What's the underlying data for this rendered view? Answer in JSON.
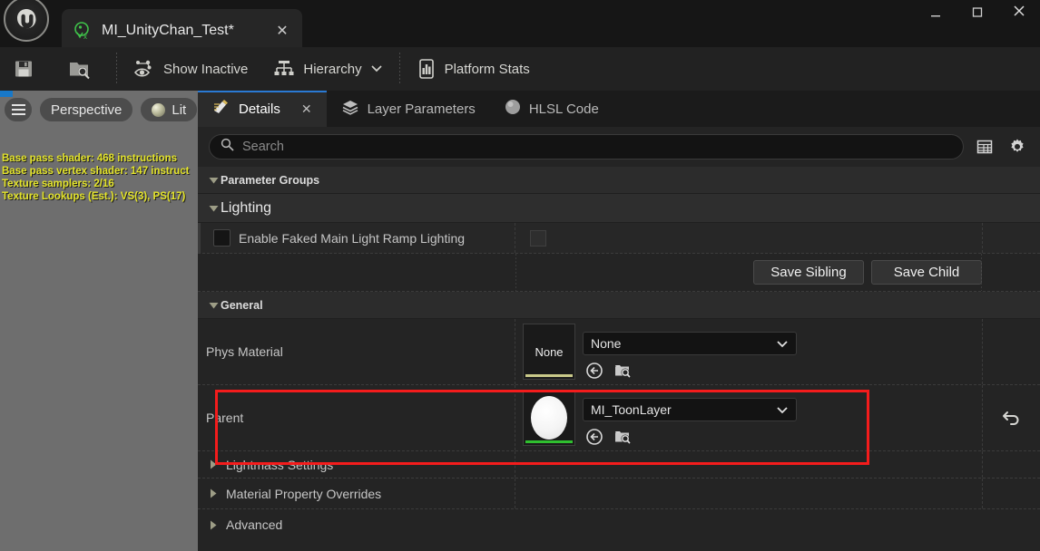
{
  "window": {
    "minimize_label": "–",
    "maximize_label": "❐",
    "close_label": "✕",
    "logo_name": "unreal-engine-logo"
  },
  "document_tab": {
    "title": "MI_UnityChan_Test*",
    "close_label": "✕",
    "icon": "material-instance-icon"
  },
  "toolbar": {
    "save_label": "",
    "browse_label": "",
    "show_inactive_label": "Show Inactive",
    "hierarchy_label": "Hierarchy",
    "hierarchy_caret": "⌄",
    "platform_stats_label": "Platform Stats"
  },
  "viewport": {
    "menu_icon": "hamburger-icon",
    "camera_mode": "Perspective",
    "view_mode": "Lit",
    "stats": [
      "Base pass shader: 468 instructions",
      "Base pass vertex shader: 147 instruct",
      "Texture samplers: 2/16",
      "Texture Lookups (Est.): VS(3), PS(17)"
    ]
  },
  "panel_tabs": [
    {
      "label": "Details",
      "icon": "details-pencil-icon",
      "active": true,
      "close_label": "✕"
    },
    {
      "label": "Layer Parameters",
      "icon": "layers-icon",
      "active": false
    },
    {
      "label": "HLSL Code",
      "icon": "sphere-icon",
      "active": false
    }
  ],
  "search": {
    "placeholder": "Search",
    "value": "",
    "icon": "search-icon",
    "columns_icon": "column-settings-icon",
    "settings_icon": "gear-icon"
  },
  "sections": {
    "parameter_groups": {
      "label": "Parameter Groups",
      "expanded": true
    },
    "lighting": {
      "label": "Lighting",
      "expanded": true
    },
    "general": {
      "label": "General",
      "expanded": true
    },
    "lightmass_settings": {
      "label": "Lightmass Settings",
      "expanded": false
    },
    "material_property_overrides": {
      "label": "Material Property Overrides",
      "expanded": false
    },
    "advanced": {
      "label": "Advanced",
      "expanded": false
    }
  },
  "parameters": {
    "enable_faked_main_light": {
      "label": "Enable Faked Main Light  Ramp Lighting",
      "checked": false
    }
  },
  "buttons": {
    "save_sibling": "Save Sibling",
    "save_child": "Save Child"
  },
  "properties": {
    "phys_material": {
      "label": "Phys Material",
      "thumbnail_label": "None",
      "value": "None",
      "dropdown_caret": "⌄",
      "underline_color": "#c9c98a",
      "browse_icon": "browse-asset-icon",
      "use_selected_icon": "use-selected-asset-icon"
    },
    "parent": {
      "label": "Parent",
      "thumbnail_label": "",
      "value": "MI_ToonLayer",
      "dropdown_caret": "⌄",
      "underline_color": "#2fbf2f",
      "browse_icon": "browse-asset-icon",
      "use_selected_icon": "use-selected-asset-icon",
      "reset_icon": "reset-arrow-icon",
      "highlighted": true,
      "highlight_color": "#f41c1c"
    }
  }
}
